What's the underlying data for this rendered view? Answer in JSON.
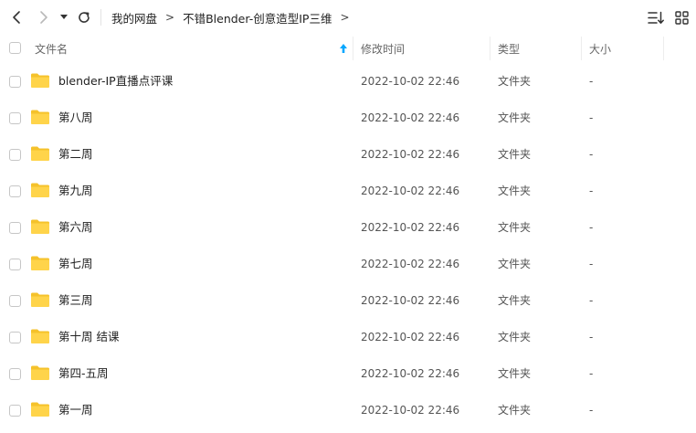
{
  "breadcrumb": [
    "我的网盘",
    "不错Blender-创意造型IP三维"
  ],
  "breadcrumb_sep": ">",
  "columns": {
    "name": "文件名",
    "mtime": "修改时间",
    "type": "类型",
    "size": "大小"
  },
  "sort": {
    "column": "name",
    "direction": "ascending"
  },
  "colors": {
    "accent": "#06a7ff",
    "folder": "#ffd44a",
    "folder_dark": "#f5c22b"
  },
  "icons": [
    "back-icon",
    "forward-icon",
    "dropdown-icon",
    "refresh-icon",
    "sort-list-icon",
    "grid-view-icon",
    "folder-icon"
  ],
  "files": [
    {
      "name": "blender-IP直播点评课",
      "mtime": "2022-10-02 22:46",
      "type": "文件夹",
      "size": "-"
    },
    {
      "name": "第八周",
      "mtime": "2022-10-02 22:46",
      "type": "文件夹",
      "size": "-"
    },
    {
      "name": "第二周",
      "mtime": "2022-10-02 22:46",
      "type": "文件夹",
      "size": "-"
    },
    {
      "name": "第九周",
      "mtime": "2022-10-02 22:46",
      "type": "文件夹",
      "size": "-"
    },
    {
      "name": "第六周",
      "mtime": "2022-10-02 22:46",
      "type": "文件夹",
      "size": "-"
    },
    {
      "name": "第七周",
      "mtime": "2022-10-02 22:46",
      "type": "文件夹",
      "size": "-"
    },
    {
      "name": "第三周",
      "mtime": "2022-10-02 22:46",
      "type": "文件夹",
      "size": "-"
    },
    {
      "name": "第十周 结课",
      "mtime": "2022-10-02 22:46",
      "type": "文件夹",
      "size": "-"
    },
    {
      "name": "第四-五周",
      "mtime": "2022-10-02 22:46",
      "type": "文件夹",
      "size": "-"
    },
    {
      "name": "第一周",
      "mtime": "2022-10-02 22:46",
      "type": "文件夹",
      "size": "-"
    }
  ]
}
